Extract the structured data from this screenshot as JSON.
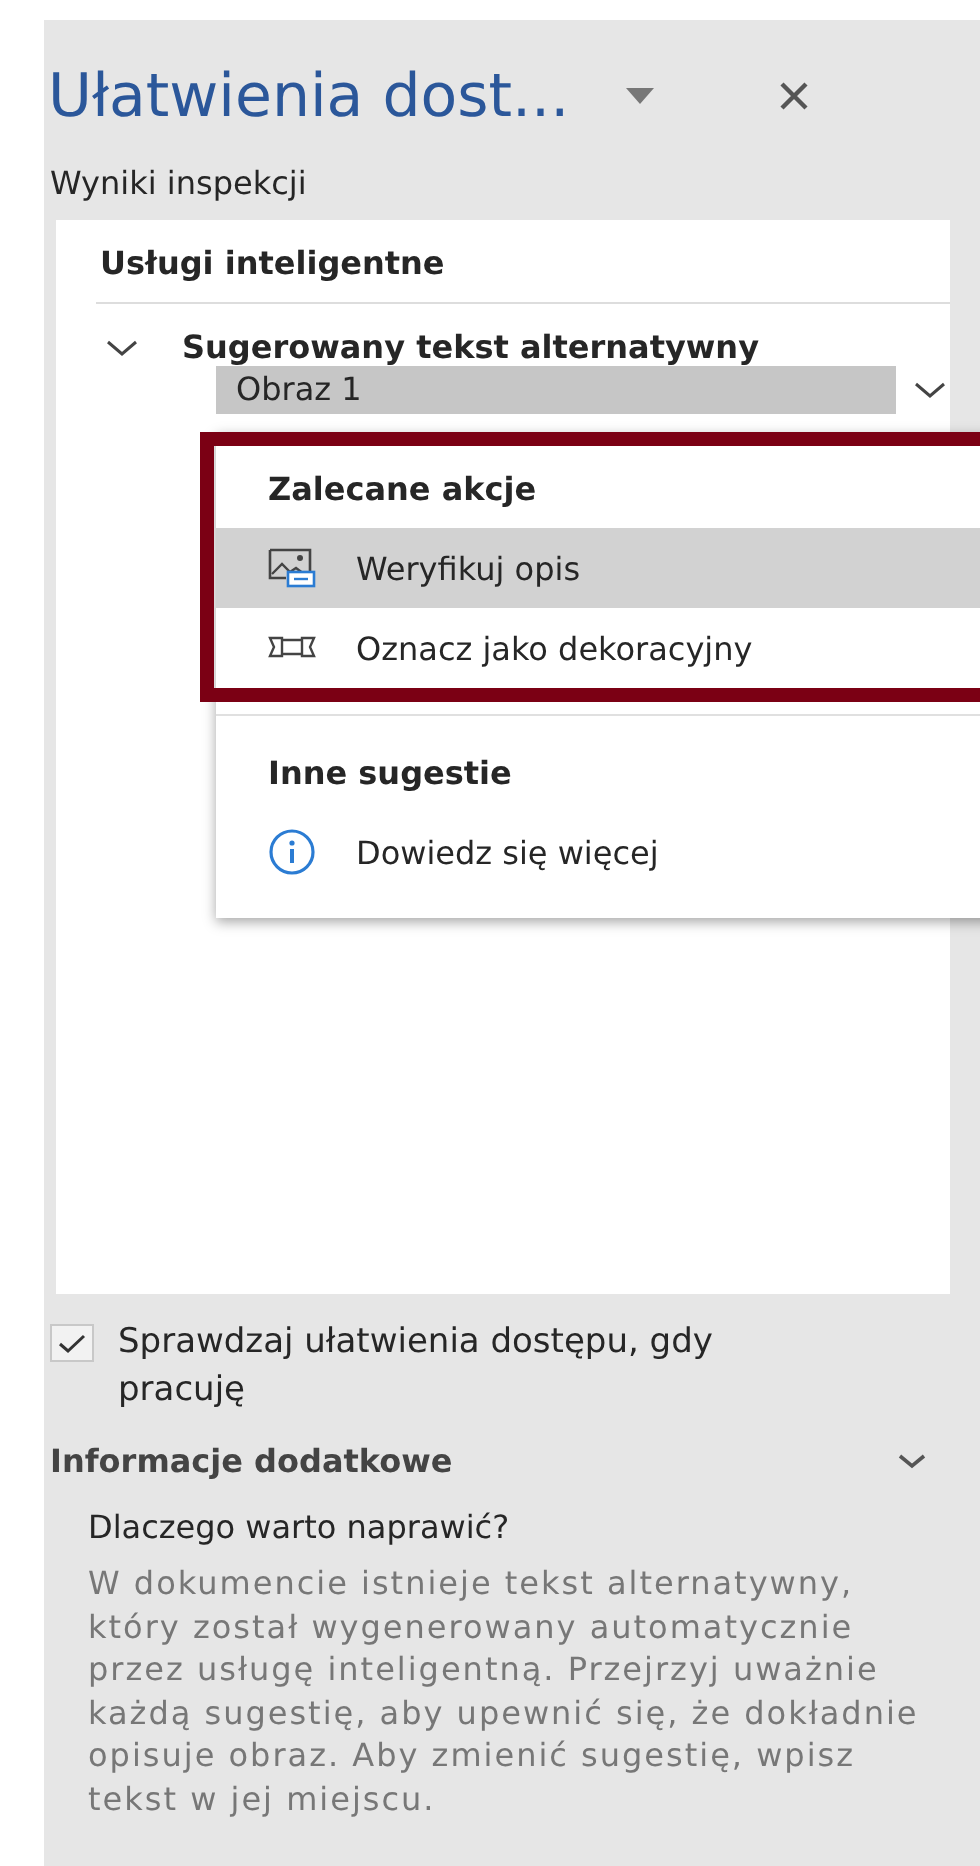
{
  "pane": {
    "title": "Ułatwienia dost...",
    "subtitle": "Wyniki inspekcji"
  },
  "results": {
    "heading": "Usługi inteligentne",
    "group": {
      "label": "Sugerowany tekst alternatywny",
      "expanded": true
    },
    "item": {
      "label": "Obraz 1",
      "selected": true
    }
  },
  "menu": {
    "sections": [
      {
        "heading": "Zalecane akcje",
        "highlighted": true,
        "items": [
          {
            "kind": "picture-text",
            "label": "Weryfikuj opis",
            "selected": true
          },
          {
            "kind": "decorative",
            "label": "Oznacz jako dekoracyjny",
            "selected": false
          }
        ]
      },
      {
        "heading": "Inne sugestie",
        "highlighted": false,
        "items": [
          {
            "kind": "info",
            "label": "Dowiedz się więcej",
            "selected": false
          }
        ]
      }
    ]
  },
  "check": {
    "label": "Sprawdzaj ułatwienia dostępu, gdy pracuję",
    "checked": true
  },
  "info": {
    "heading": "Informacje dodatkowe",
    "expanded": true,
    "question": "Dlaczego warto naprawić?",
    "text": "W dokumencie istnieje tekst alternatywny, który został wygenerowany automatycznie przez usługę inteligentną. Przejrzyj uważnie każdą sugestię, aby upewnić się, że dokładnie opisuje obraz. Aby zmienić sugestię, wpisz tekst w jej miejscu."
  }
}
